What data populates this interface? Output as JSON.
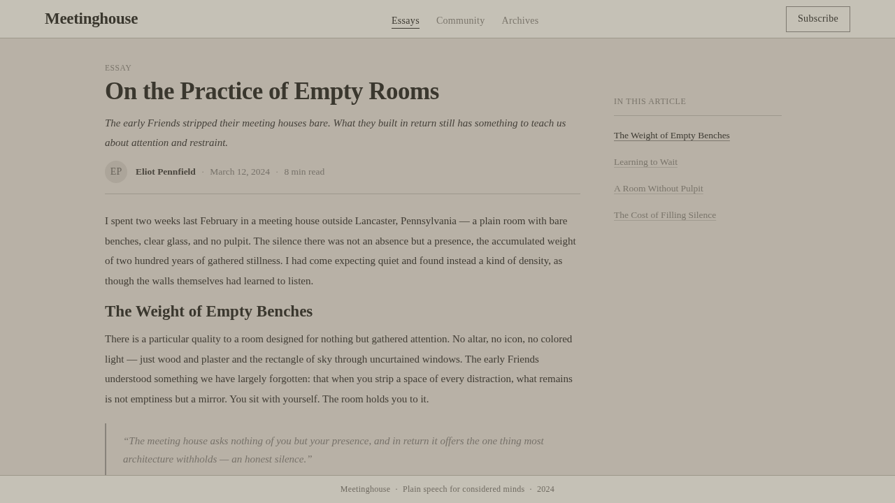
{
  "header": {
    "logo": "Meetinghouse",
    "nav": [
      {
        "label": "Essays",
        "selected": true
      },
      {
        "label": "Community",
        "selected": false
      },
      {
        "label": "Archives",
        "selected": false
      }
    ],
    "subscribe_button": "Subscribe"
  },
  "article": {
    "eyebrow": "ESSAY",
    "title": "On the Practice of Empty Rooms",
    "dek": "The early Friends stripped their meeting houses bare. What they built in return still has something to teach us about attention and restraint.",
    "avatar_initials": "EP",
    "meta": [
      {
        "kind": "author",
        "text": "Eliot Pennfield"
      },
      {
        "kind": "dot",
        "text": "·"
      },
      {
        "kind": "date",
        "text": "March 12, 2024"
      },
      {
        "kind": "dot",
        "text": "·"
      },
      {
        "kind": "read_time",
        "text": "8 min read"
      }
    ],
    "body": [
      {
        "kind": "paragraph",
        "text": "I spent two weeks last February in a meeting house outside Lancaster, Pennsylvania — a plain room with bare benches, clear glass, and no pulpit. The silence there was not an absence but a presence, the accumulated weight of two hundred years of gathered stillness. I had come expecting quiet and found instead a kind of density, as though the walls themselves had learned to listen."
      },
      {
        "kind": "heading",
        "text": "The Weight of Empty Benches"
      },
      {
        "kind": "paragraph",
        "text": "There is a particular quality to a room designed for nothing but gathered attention. No altar, no icon, no colored light — just wood and plaster and the rectangle of sky through uncurtained windows. The early Friends understood something we have largely forgotten: that when you strip a space of every distraction, what remains is not emptiness but a mirror. You sit with yourself. The room holds you to it."
      },
      {
        "kind": "quote",
        "text": "“The meeting house asks nothing of you but your presence, and in return it offers the one thing most architecture withholds — an honest silence.”"
      }
    ]
  },
  "toc": {
    "title": "IN THIS ARTICLE",
    "items": [
      {
        "label": "The Weight of Empty Benches",
        "selected": true
      },
      {
        "label": "Learning to Wait",
        "selected": false
      },
      {
        "label": "A Room Without Pulpit",
        "selected": false
      },
      {
        "label": "The Cost of Filling Silence",
        "selected": false
      }
    ]
  },
  "footer": {
    "text": "Meetinghouse  ·  Plain speech for considered minds  ·  2024"
  }
}
